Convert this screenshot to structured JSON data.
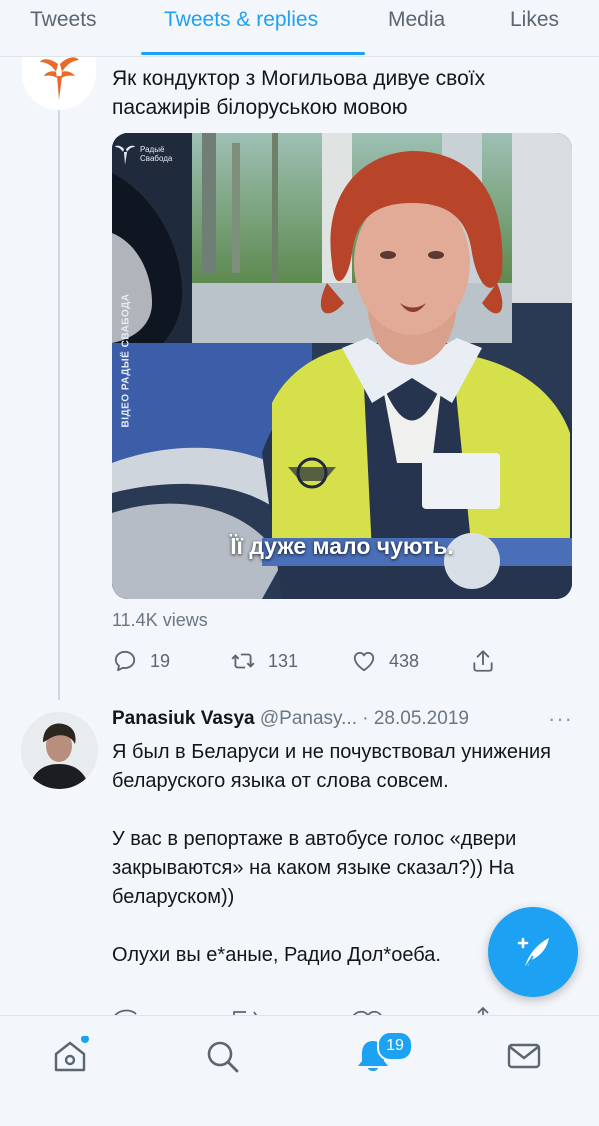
{
  "tabs": [
    {
      "label": "Tweets"
    },
    {
      "label": "Tweets & replies"
    },
    {
      "label": "Media"
    },
    {
      "label": "Likes"
    }
  ],
  "tweet1": {
    "text": "Як кондуктор з Могильова дивуе своїх пасажирів білоруською мовою",
    "media": {
      "subtitle": "Її дуже мало чують.",
      "watermark_logo": "Радыё Свабода",
      "side_label": "ВІДЕО РАДЫЁ СВАБОДА"
    },
    "views": "11.4K views",
    "actions": {
      "replies": "19",
      "retweets": "131",
      "likes": "438"
    }
  },
  "tweet2": {
    "name": "Panasiuk Vasya",
    "handle_date": " @Panasy... · 28.05.2019",
    "paragraphs": [
      "Я был в Беларуси и не почувствовал унижения беларуского языка от слова совсем.",
      "У вас в репортаже в автобусе голос «двери закрываются» на каком языке сказал?)) На беларуском))",
      "Олухи вы е*аные, Радио Дол*оеба."
    ]
  },
  "bottom_nav": {
    "notifications_badge": "19"
  },
  "colors": {
    "accent": "#1da1f2",
    "background": "#f3f6fb"
  }
}
